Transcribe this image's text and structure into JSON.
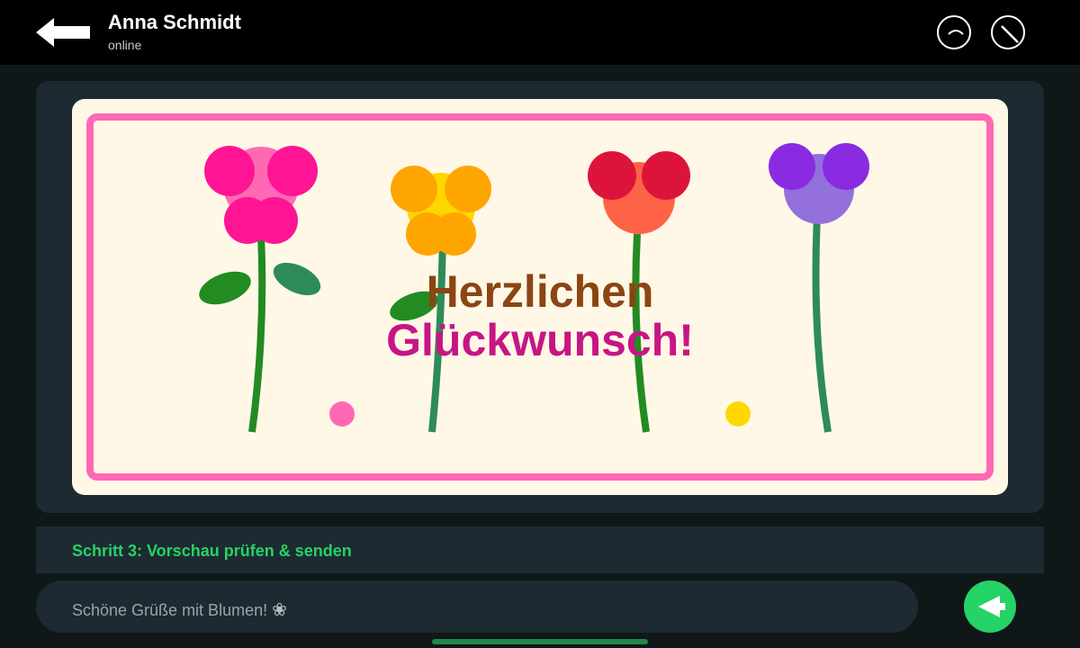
{
  "header": {
    "contact_name": "Anna Schmidt",
    "status": "online"
  },
  "card": {
    "greeting_line1": "Herzlichen",
    "greeting_line2": "Glückwunsch!",
    "colors": {
      "background": "#fff8e7",
      "border": "#ff69b4",
      "line1": "#8b4513",
      "line2": "#c71585"
    },
    "flowers": [
      {
        "color": "pink",
        "petal": "#ff1493",
        "center": "#ff69b4"
      },
      {
        "color": "yellow",
        "petal": "#ffa500",
        "center": "#ffd700"
      },
      {
        "color": "red",
        "petal": "#dc143c",
        "center": "#ff6347"
      },
      {
        "color": "purple",
        "petal": "#8a2be2",
        "center": "#9370db"
      }
    ]
  },
  "step": {
    "label": "Schritt 3: Vorschau prüfen & senden"
  },
  "composer": {
    "message": "Schöne Grüße mit Blumen!",
    "emoji": "❀"
  },
  "icons": {
    "back": "arrow-left-icon",
    "call": "phone-icon",
    "block": "block-icon",
    "send": "send-icon"
  },
  "colors": {
    "accent": "#25d366",
    "topbar": "#000000",
    "panel": "#1e2a32"
  }
}
